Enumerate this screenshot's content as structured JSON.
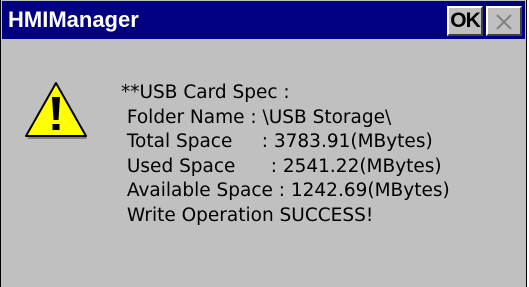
{
  "dialog": {
    "title": "HMIManager",
    "ok_label": "OK",
    "close_glyph": "×",
    "icon": "warning-icon",
    "message_lines": [
      "**USB Card Spec :",
      " Folder Name : \\USB Storage\\",
      " Total Space     : 3783.91(MBytes)",
      " Used Space      : 2541.22(MBytes)",
      " Available Space : 1242.69(MBytes)",
      " Write Operation SUCCESS!"
    ]
  },
  "colors": {
    "titlebar": "#000080",
    "title_text": "#ffffff",
    "dialog_face": "#c0c0c0",
    "icon_fill": "#ffff00"
  }
}
